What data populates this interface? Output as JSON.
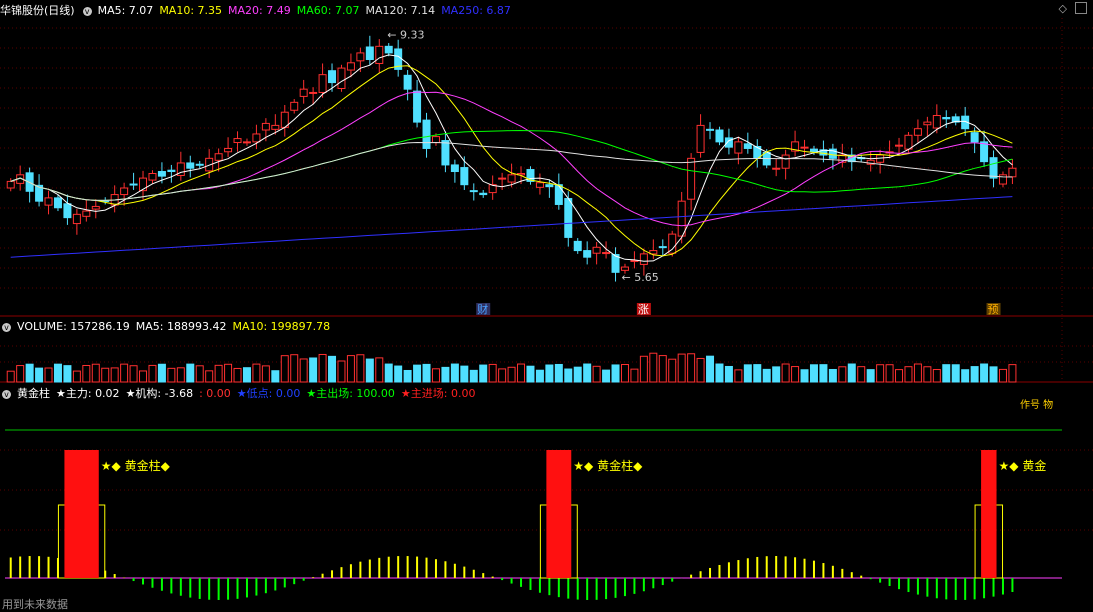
{
  "window": {
    "up_icon": "diamond-icon",
    "close_icon": "close-box-icon"
  },
  "price_panel": {
    "stock": "华锦股份(日线)",
    "ma": [
      {
        "label": "MA5: 7.07",
        "color": "#ffffff"
      },
      {
        "label": "MA10: 7.35",
        "color": "#ffff00"
      },
      {
        "label": "MA20: 7.49",
        "color": "#ff40ff"
      },
      {
        "label": "MA60: 7.07",
        "color": "#00ff00"
      },
      {
        "label": "MA120: 7.14",
        "color": "#e0e0e0"
      },
      {
        "label": "MA250: 6.87",
        "color": "#3030ff"
      }
    ],
    "high_label": "9.33",
    "low_label": "5.65",
    "markers": [
      {
        "text": "财",
        "index": 50,
        "color": "#4aa0ff",
        "bg": "#303060"
      },
      {
        "text": "涨",
        "index": 67,
        "color": "#ffffff",
        "bg": "#c01010"
      },
      {
        "text": "预",
        "index": 104,
        "color": "#ffb000",
        "bg": "#604000"
      }
    ]
  },
  "volume_panel": {
    "title": "VOLUME: 157286.19",
    "ma5": "MA5: 188993.42",
    "ma10": "MA10: 199897.78"
  },
  "indicator_panel": {
    "name": "黄金柱",
    "items": [
      {
        "label": "★主力: 0.02",
        "color": "#ffffff"
      },
      {
        "label": "★机构: -3.68",
        "color": "#ffffff"
      },
      {
        "label": ": 0.00",
        "color": "#ff3030"
      },
      {
        "label": "★低点: 0.00",
        "color": "#2040ff"
      },
      {
        "label": "★主出场: 100.00",
        "color": "#00ff00"
      },
      {
        "label": "★主进场: 0.00",
        "color": "#ff2020"
      }
    ],
    "tag_text": "★◆ 黄金柱◆",
    "tag_short": "★◆ 黄金",
    "corner_text": "作号 物"
  },
  "footer": "用到未来数据",
  "chart_data": {
    "type": "candlestick",
    "series": [
      {
        "name": "MA5",
        "color": "#ffffff"
      },
      {
        "name": "MA10",
        "color": "#ffff00"
      },
      {
        "name": "MA20",
        "color": "#ff40ff"
      },
      {
        "name": "MA60",
        "color": "#00ff00"
      },
      {
        "name": "MA120",
        "color": "#e0e0e0"
      },
      {
        "name": "MA250",
        "color": "#3030ff"
      }
    ],
    "last_values": {
      "MA5": 7.07,
      "MA10": 7.35,
      "MA20": 7.49,
      "MA60": 7.07,
      "MA120": 7.14,
      "MA250": 6.87
    },
    "high": 9.33,
    "low": 5.65,
    "close": [
      7.1,
      7.2,
      6.95,
      6.8,
      6.85,
      6.7,
      6.55,
      6.6,
      6.65,
      6.72,
      6.8,
      6.9,
      7.0,
      7.05,
      7.15,
      7.22,
      7.18,
      7.25,
      7.38,
      7.3,
      7.35,
      7.45,
      7.52,
      7.6,
      7.75,
      7.7,
      7.82,
      7.98,
      7.95,
      8.15,
      8.3,
      8.5,
      8.45,
      8.72,
      8.6,
      8.82,
      8.9,
      9.05,
      8.95,
      9.15,
      9.05,
      8.8,
      8.5,
      8.0,
      7.6,
      7.78,
      7.35,
      7.25,
      7.05,
      6.95,
      6.9,
      7.05,
      7.15,
      7.2,
      7.22,
      7.1,
      7.08,
      7.02,
      6.75,
      6.25,
      6.05,
      5.95,
      6.1,
      6.02,
      5.72,
      5.8,
      5.9,
      6.0,
      6.05,
      6.1,
      6.3,
      6.8,
      7.45,
      7.95,
      7.88,
      7.7,
      7.62,
      7.7,
      7.6,
      7.45,
      7.35,
      7.3,
      7.5,
      7.7,
      7.62,
      7.55,
      7.5,
      7.45,
      7.5,
      7.4,
      7.45,
      7.42,
      7.5,
      7.55,
      7.65,
      7.8,
      7.9,
      8.0,
      8.1,
      8.05,
      8.0,
      7.9,
      7.7,
      7.4,
      7.15,
      7.2,
      7.3
    ],
    "volume_range": [
      0,
      400000
    ],
    "indicator_bars": [
      {
        "start": 6,
        "end": 9,
        "value": 100
      },
      {
        "start": 57,
        "end": 59,
        "value": 100
      },
      {
        "start": 103,
        "end": 104,
        "value": 100
      }
    ]
  }
}
